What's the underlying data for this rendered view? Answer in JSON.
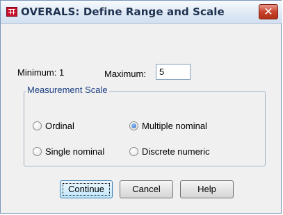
{
  "window": {
    "title": "OVERALS: Define Range and Scale",
    "close_glyph": "✕"
  },
  "range": {
    "minimum_label": "Minimum: 1",
    "maximum_label": "Maximum:",
    "maximum_value": "5"
  },
  "measurement_scale": {
    "legend": "Measurement Scale",
    "options": [
      {
        "label": "Ordinal",
        "checked": false
      },
      {
        "label": "Multiple nominal",
        "checked": true
      },
      {
        "label": "Single nominal",
        "checked": false
      },
      {
        "label": "Discrete numeric",
        "checked": false
      }
    ]
  },
  "buttons": {
    "continue": "Continue",
    "cancel": "Cancel",
    "help": "Help"
  },
  "colors": {
    "legend_text": "#1c3f82",
    "selected_radio": "#1f5fb8",
    "close_button": "#c8442c"
  },
  "icons": {
    "app": "spss-grid-icon",
    "close": "close-icon"
  }
}
